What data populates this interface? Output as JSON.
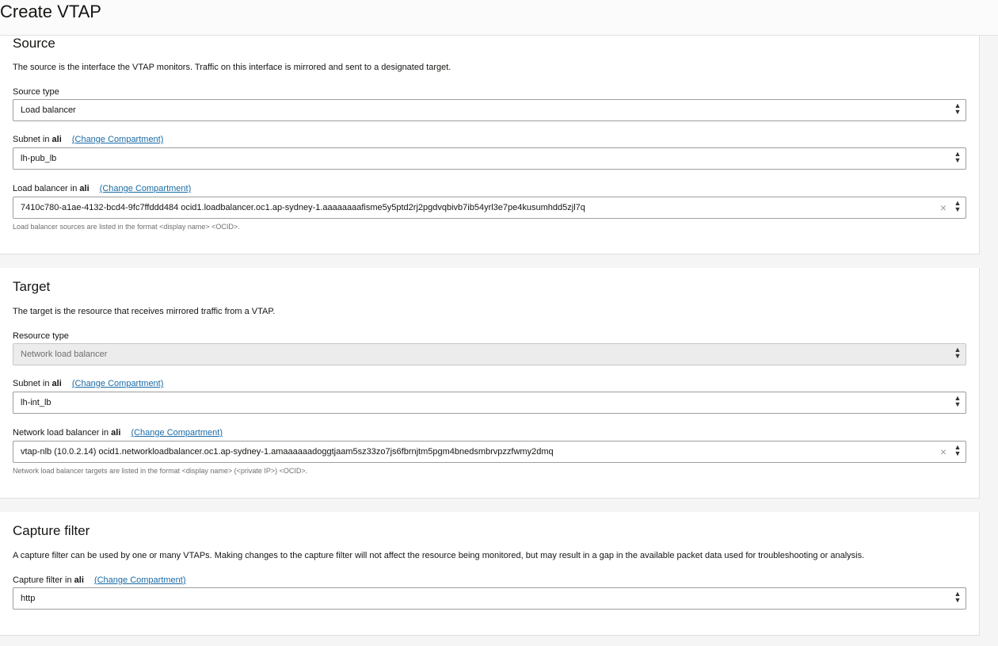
{
  "page": {
    "title": "Create VTAP"
  },
  "source": {
    "title": "Source",
    "description": "The source is the interface the VTAP monitors. Traffic on this interface is mirrored and sent to a designated target.",
    "source_type": {
      "label": "Source type",
      "value": "Load balancer"
    },
    "subnet": {
      "label_prefix": "Subnet in",
      "compartment": "ali",
      "change_link": "(Change Compartment)",
      "value": "lh-pub_lb"
    },
    "load_balancer": {
      "label_prefix": "Load balancer in",
      "compartment": "ali",
      "change_link": "(Change Compartment)",
      "value": "7410c780-a1ae-4132-bcd4-9fc7ffddd484 ocid1.loadbalancer.oc1.ap-sydney-1.aaaaaaaafisme5y5ptd2rj2pgdvqbivb7ib54yrl3e7pe4kusumhdd5zjl7q",
      "help": "Load balancer sources are listed in the format <display name> <OCID>."
    }
  },
  "target": {
    "title": "Target",
    "description": "The target is the resource that receives mirrored traffic from a VTAP.",
    "resource_type": {
      "label": "Resource type",
      "value": "Network load balancer"
    },
    "subnet": {
      "label_prefix": "Subnet in",
      "compartment": "ali",
      "change_link": "(Change Compartment)",
      "value": "lh-int_lb"
    },
    "network_load_balancer": {
      "label_prefix": "Network load balancer in",
      "compartment": "ali",
      "change_link": "(Change Compartment)",
      "value": "vtap-nlb (10.0.2.14) ocid1.networkloadbalancer.oc1.ap-sydney-1.amaaaaaadoggtjaam5sz33zo7js6fbrnjtm5pgm4bnedsmbrvpzzfwmy2dmq",
      "help": "Network load balancer targets are listed in the format <display name> (<private IP>) <OCID>."
    }
  },
  "capture_filter": {
    "title": "Capture filter",
    "description": "A capture filter can be used by one or many VTAPs. Making changes to the capture filter will not affect the resource being monitored, but may result in a gap in the available packet data used for troubleshooting or analysis.",
    "filter": {
      "label_prefix": "Capture filter in",
      "compartment": "ali",
      "change_link": "(Change Compartment)",
      "value": "http"
    }
  },
  "icons": {
    "select_caret": "up-down-chevron-icon",
    "clear": "clear-x-icon"
  },
  "colors": {
    "link": "#1a6ba5",
    "background": "#f5f5f5"
  }
}
